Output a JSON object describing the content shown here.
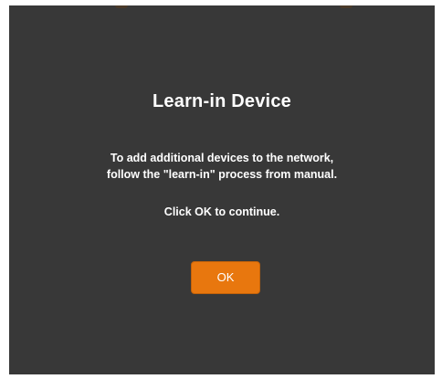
{
  "dialog": {
    "title": "Learn-in Device",
    "message_line1": "To add additional devices to the network,",
    "message_line2": "follow the \"learn-in\" process from manual.",
    "continue_text": "Click OK to continue.",
    "ok_label": "OK"
  },
  "colors": {
    "dialog_background": "#383838",
    "accent": "#e8770e",
    "text": "#ffffff"
  }
}
